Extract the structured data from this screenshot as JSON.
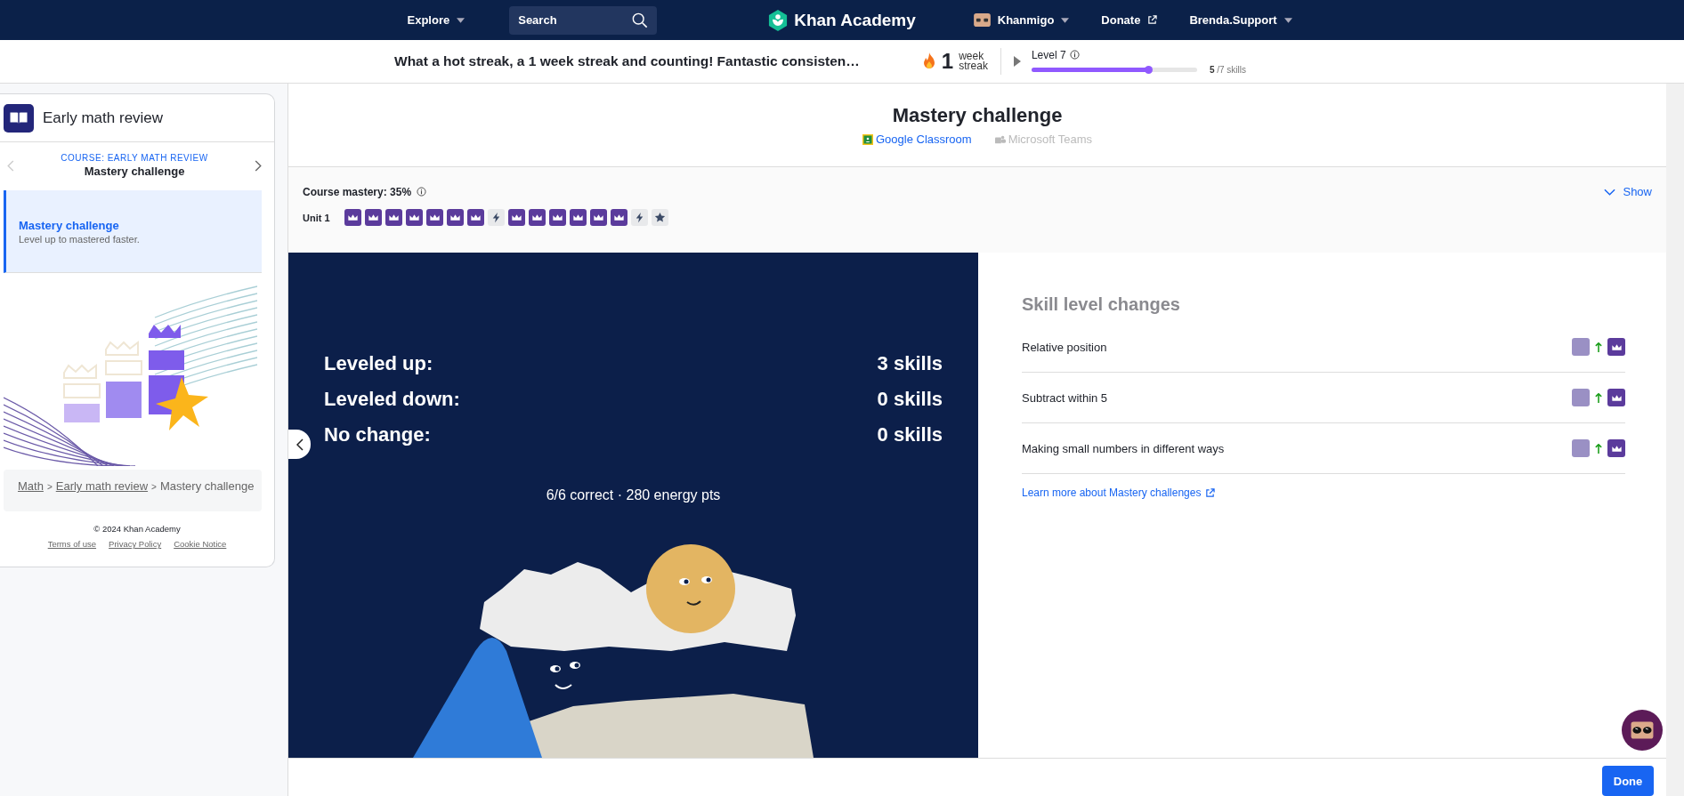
{
  "nav": {
    "explore": "Explore",
    "search": {
      "placeholder": "Search"
    },
    "logo": "Khan Academy",
    "khanmigo": "Khanmigo",
    "donate": "Donate",
    "user": "Brenda.Support"
  },
  "streak_bar": {
    "message": "What a hot streak, a 1 week streak and counting! Fantastic consisten…",
    "streak_count": "1",
    "streak_word_1": "week",
    "streak_word_2": "streak",
    "level_label": "Level 7",
    "level": 0.71,
    "skills_done": "5",
    "skills_total": "/7 skills"
  },
  "sidebar": {
    "course_title": "Early math review",
    "course_label": "COURSE: EARLY MATH REVIEW",
    "current": "Mastery challenge",
    "items": [
      {
        "title": "Mastery challenge",
        "subtitle": "Level up to mastered faster.",
        "selected": true
      }
    ],
    "breadcrumb": [
      {
        "label": "Math",
        "link": true
      },
      {
        "label": "Early math review",
        "link": true
      },
      {
        "label": "Mastery challenge",
        "link": false
      }
    ],
    "separator": ">",
    "copyright": "© 2024 Khan Academy",
    "footer_links": [
      "Terms of use",
      "Privacy Policy",
      "Cookie Notice"
    ]
  },
  "header": {
    "title": "Mastery challenge",
    "share": [
      {
        "label": "Google Classroom",
        "kind": "classroom",
        "disabled": false
      },
      {
        "label": "Microsoft Teams",
        "kind": "teams",
        "disabled": true
      }
    ]
  },
  "course_mastery": {
    "label": "Course mastery: 35%",
    "show": "Show",
    "units": [
      {
        "name": "Unit 1",
        "skills": [
          {
            "kind": "mastered"
          },
          {
            "kind": "mastered"
          },
          {
            "kind": "mastered"
          },
          {
            "kind": "mastered"
          },
          {
            "kind": "mastered"
          },
          {
            "kind": "mastered"
          },
          {
            "kind": "mastered"
          },
          {
            "kind": "energy"
          },
          {
            "kind": "mastered"
          },
          {
            "kind": "mastered"
          },
          {
            "kind": "mastered"
          },
          {
            "kind": "mastered"
          },
          {
            "kind": "mastered"
          },
          {
            "kind": "mastered"
          },
          {
            "kind": "energy"
          },
          {
            "kind": "star"
          }
        ]
      }
    ]
  },
  "results": {
    "rows": [
      {
        "label": "Leveled up:",
        "value": "3 skills"
      },
      {
        "label": "Leveled down:",
        "value": "0 skills"
      },
      {
        "label": "No change:",
        "value": "0 skills"
      }
    ],
    "summary": "6/6 correct · 280 energy pts"
  },
  "skill_changes": {
    "title": "Skill level changes",
    "rows": [
      {
        "name": "Relative position",
        "levels": [
          {
            "kind": "proficient"
          },
          {
            "kind": "mastered"
          }
        ]
      },
      {
        "name": "Subtract within 5",
        "levels": [
          {
            "kind": "proficient"
          },
          {
            "kind": "mastered"
          }
        ]
      },
      {
        "name": "Making small numbers in different ways",
        "levels": [
          {
            "kind": "proficient"
          },
          {
            "kind": "mastered"
          }
        ]
      }
    ],
    "learn_more": "Learn more about Mastery challenges"
  },
  "done": "Done"
}
